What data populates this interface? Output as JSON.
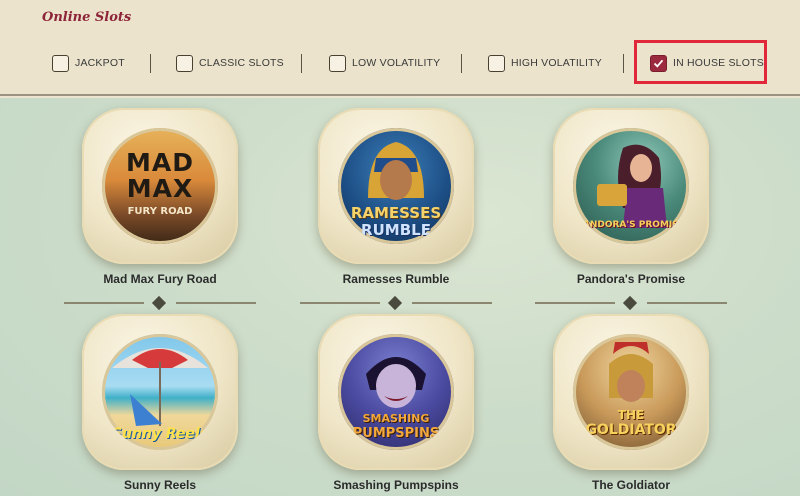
{
  "header": {
    "title": "Online Slots"
  },
  "filters": [
    {
      "label": "JACKPOT",
      "checked": false
    },
    {
      "label": "CLASSIC SLOTS",
      "checked": false
    },
    {
      "label": "LOW VOLATILITY",
      "checked": false
    },
    {
      "label": "HIGH VOLATILITY",
      "checked": false
    },
    {
      "label": "IN HOUSE SLOTS",
      "checked": true
    }
  ],
  "games": [
    {
      "name": "Mad Max Fury Road",
      "logo": [
        "MAD",
        "MAX",
        "FURY ROAD"
      ]
    },
    {
      "name": "Ramesses Rumble",
      "logo": [
        "RAMESSES",
        "RUMBLE"
      ]
    },
    {
      "name": "Pandora's Promise",
      "logo": [
        "PANDORA'S PROMISE"
      ]
    },
    {
      "name": "Sunny Reels",
      "logo": [
        "Sunny Reels"
      ]
    },
    {
      "name": "Smashing Pumpspins",
      "logo": [
        "SMASHING",
        "PUMPSPINS"
      ]
    },
    {
      "name": "The Goldiator",
      "logo": [
        "THE",
        "GOLDIATOR"
      ]
    }
  ],
  "colors": {
    "accent": "#8d2438",
    "highlight": "#e0283a",
    "checkbox_checked": "#9c2a3f"
  }
}
